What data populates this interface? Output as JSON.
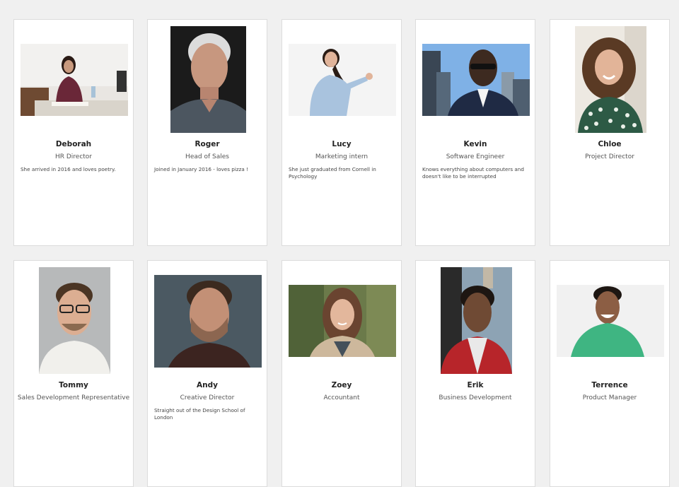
{
  "team": [
    {
      "name": "Deborah",
      "title": "HR Director",
      "description": "She arrived in 2016 and loves poetry.",
      "photo": "woman-at-desk-photo"
    },
    {
      "name": "Roger",
      "title": "Head of Sales",
      "description": "Joined in January 2016 - loves pizza !",
      "photo": "grey-haired-man-photo"
    },
    {
      "name": "Lucy",
      "title": "Marketing intern",
      "description": "She just graduated from Cornell in Psychology",
      "photo": "woman-pointing-photo"
    },
    {
      "name": "Kevin",
      "title": "Software Engineer",
      "description": "Knows everything about computers and doesn't like to be interrupted",
      "photo": "man-sunglasses-city-photo"
    },
    {
      "name": "Chloe",
      "title": "Project Director",
      "description": "",
      "photo": "woman-curly-hair-photo"
    },
    {
      "name": "Tommy",
      "title": "Sales Development Representative",
      "description": "",
      "photo": "man-glasses-photo"
    },
    {
      "name": "Andy",
      "title": "Creative Director",
      "description": "Straight out of the Design School of London",
      "photo": "young-man-portrait-photo"
    },
    {
      "name": "Zoey",
      "title": "Accountant",
      "description": "",
      "photo": "woman-outdoor-photo"
    },
    {
      "name": "Erik",
      "title": "Business Development",
      "description": "",
      "photo": "man-red-jacket-photo"
    },
    {
      "name": "Terrence",
      "title": "Product Manager",
      "description": "",
      "photo": "man-green-shirt-photo"
    }
  ]
}
